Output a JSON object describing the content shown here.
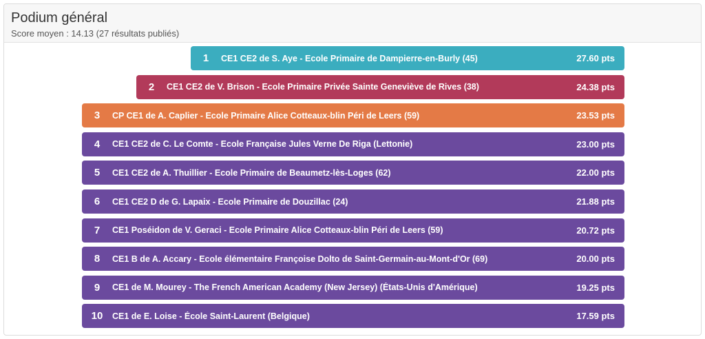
{
  "header": {
    "title": "Podium général",
    "subtitle": "Score moyen : 14.13 (27 résultats publiés)"
  },
  "colors": {
    "first": "#3badbf",
    "second": "#b23a5a",
    "third": "#e47a46",
    "others": "#6b4a9e"
  },
  "podium": [
    {
      "rank": "1",
      "label": "CE1 CE2 de S. Aye - Ecole Primaire de Dampierre-en-Burly (45)",
      "score": "27.60 pts",
      "color": "#3badbf"
    },
    {
      "rank": "2",
      "label": "CE1 CE2 de V. Brison - Ecole Primaire Privée Sainte Geneviève de Rives (38)",
      "score": "24.38 pts",
      "color": "#b23a5a"
    },
    {
      "rank": "3",
      "label": "CP CE1 de A. Caplier - Ecole Primaire Alice Cotteaux-blin Péri de Leers (59)",
      "score": "23.53 pts",
      "color": "#e47a46"
    },
    {
      "rank": "4",
      "label": "CE1 CE2 de C. Le Comte - Ecole Française Jules Verne De Riga (Lettonie)",
      "score": "23.00 pts",
      "color": "#6b4a9e"
    },
    {
      "rank": "5",
      "label": "CE1 CE2 de A. Thuillier - Ecole Primaire de Beaumetz-lès-Loges (62)",
      "score": "22.00 pts",
      "color": "#6b4a9e"
    },
    {
      "rank": "6",
      "label": "CE1 CE2 D de G. Lapaix - Ecole Primaire de Douzillac (24)",
      "score": "21.88 pts",
      "color": "#6b4a9e"
    },
    {
      "rank": "7",
      "label": "CE1 Poséidon de V. Geraci - Ecole Primaire Alice Cotteaux-blin Péri de Leers (59)",
      "score": "20.72 pts",
      "color": "#6b4a9e"
    },
    {
      "rank": "8",
      "label": "CE1 B de A. Accary - Ecole élémentaire Françoise Dolto de Saint-Germain-au-Mont-d'Or (69)",
      "score": "20.00 pts",
      "color": "#6b4a9e"
    },
    {
      "rank": "9",
      "label": "CE1 de M. Mourey - The French American Academy (New Jersey) (États-Unis d'Amérique)",
      "score": "19.25 pts",
      "color": "#6b4a9e"
    },
    {
      "rank": "10",
      "label": "CE1 de E. Loise - École Saint-Laurent (Belgique)",
      "score": "17.59 pts",
      "color": "#6b4a9e"
    }
  ]
}
